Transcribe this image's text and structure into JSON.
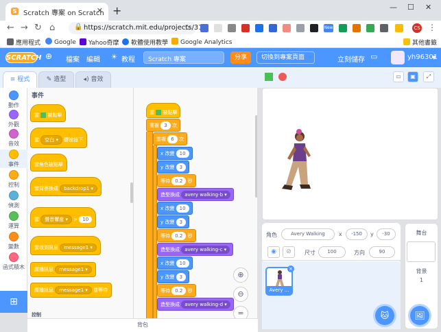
{
  "browser": {
    "tab_title": "Scratch 專案 on Scratch",
    "url": "https://scratch.mit.edu/projects/31...",
    "new_tab": "+",
    "bookmarks": [
      "應用程式",
      "Google",
      "Yahoo奇摩",
      "軟體使用教學",
      "Google Analytics"
    ],
    "other_bookmarks": "其他書籤",
    "profile_initials": "CS",
    "ext_badge": "New"
  },
  "menubar": {
    "logo": "SCRATCH",
    "file": "檔案",
    "edit": "編輯",
    "tutorials": "教程",
    "project_title": "Scratch 專案",
    "share": "分享",
    "project_page": "切換到專案頁面",
    "save_now": "立刻儲存",
    "username": "yh96301"
  },
  "tabs": {
    "code": "程式",
    "costumes": "造型",
    "sounds": "音效"
  },
  "categories": [
    {
      "label": "動作",
      "color": "#4c97ff"
    },
    {
      "label": "外觀",
      "color": "#9966ff"
    },
    {
      "label": "音效",
      "color": "#cf63cf"
    },
    {
      "label": "事件",
      "color": "#ffbf00"
    },
    {
      "label": "控制",
      "color": "#ffab19"
    },
    {
      "label": "偵測",
      "color": "#5cb1d6"
    },
    {
      "label": "運算",
      "color": "#59c059"
    },
    {
      "label": "變數",
      "color": "#ff8c1a"
    },
    {
      "label": "函式積木",
      "color": "#ff6680"
    }
  ],
  "palette": {
    "section": "事件",
    "blocks": {
      "flag_clicked": "當",
      "flag_clicked_suffix": "被點擊",
      "key_pressed_prefix": "當",
      "key": "空白",
      "key_pressed_suffix": "鍵被按下",
      "sprite_clicked": "當角色被點擊",
      "backdrop_prefix": "當背景換成",
      "backdrop": "backdrop1",
      "loudness_prefix": "當",
      "loudness": "聲音響度",
      "loudness_value": "10",
      "receive_prefix": "當收到訊息",
      "message1": "message1",
      "broadcast": "廣播訊息",
      "broadcast_wait": "廣播訊息",
      "broadcast_wait_suffix": "並等待"
    },
    "next_section": "控制"
  },
  "script": {
    "hat_prefix": "當",
    "hat_suffix": "被點擊",
    "repeat_label": "重複",
    "repeat_outer": "3",
    "repeat_inner": "6",
    "times": "次",
    "steps": [
      {
        "kind": "b",
        "label": "x 改變",
        "value": "10"
      },
      {
        "kind": "b",
        "label": "y 改變",
        "value": "3"
      },
      {
        "kind": "o",
        "label": "等待",
        "value": "0.2",
        "unit": "秒"
      },
      {
        "kind": "p",
        "label": "造型換成",
        "value": "avery walking-b"
      },
      {
        "kind": "b",
        "label": "x 改變",
        "value": "10"
      },
      {
        "kind": "b",
        "label": "y 改變",
        "value": "3"
      },
      {
        "kind": "o",
        "label": "等待",
        "value": "0.2",
        "unit": "秒"
      },
      {
        "kind": "p",
        "label": "造型換成",
        "value": "avery walking-c"
      },
      {
        "kind": "b",
        "label": "x 改變",
        "value": "10"
      },
      {
        "kind": "b",
        "label": "y 改變",
        "value": "3"
      },
      {
        "kind": "o",
        "label": "等待",
        "value": "0.2",
        "unit": "秒"
      },
      {
        "kind": "p",
        "label": "造型換成",
        "value": "avery walking-d"
      }
    ]
  },
  "backpack": "背包",
  "sprite": {
    "label": "角色",
    "name": "Avery Walking",
    "x_label": "x",
    "x": "-150",
    "y_label": "y",
    "y": "-30",
    "size_label": "尺寸",
    "size": "100",
    "direction_label": "方向",
    "direction": "90",
    "thumb_label": "Avery ..."
  },
  "stage_pane": {
    "title": "舞台",
    "backdrops_label": "背景",
    "backdrops_count": "1"
  }
}
